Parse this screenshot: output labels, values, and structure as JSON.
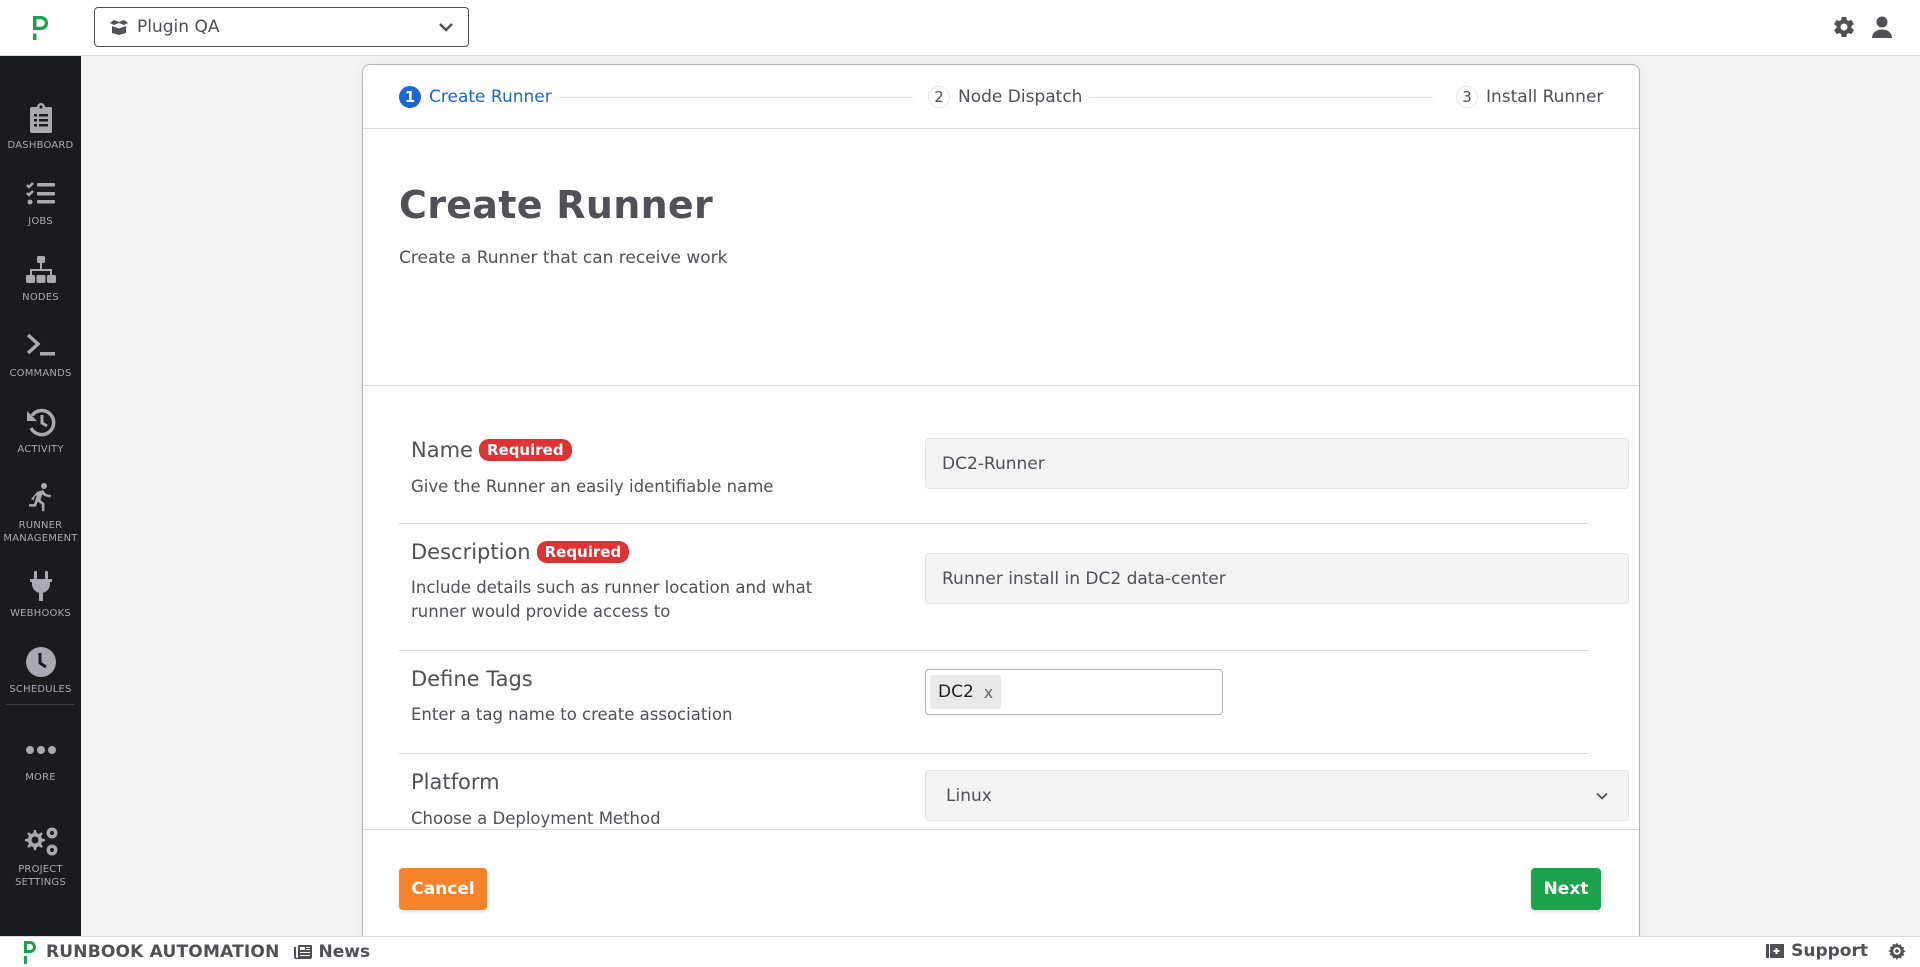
{
  "app": {
    "name": "Runbook Automation",
    "brand_color": "#1aa24d"
  },
  "topbar": {
    "project_select": {
      "icon": "box-open-icon",
      "value": "Plugin QA"
    },
    "icons": [
      "gear-icon",
      "user-icon"
    ]
  },
  "sidebar": {
    "items": [
      {
        "label": "Dashboard",
        "icon": "clipboard-list-icon"
      },
      {
        "label": "Jobs",
        "icon": "tasks-list-icon"
      },
      {
        "label": "Nodes",
        "icon": "sitemap-icon"
      },
      {
        "label": "Commands",
        "icon": "terminal-icon"
      },
      {
        "label": "Activity",
        "icon": "history-icon"
      },
      {
        "label": "Runner Management",
        "icon": "running-icon"
      },
      {
        "label": "Webhooks",
        "icon": "plug-icon"
      },
      {
        "label": "Schedules",
        "icon": "clock-icon"
      },
      {
        "label": "More",
        "icon": "ellipsis-icon"
      },
      {
        "label": "Project Settings",
        "icon": "cogs-icon"
      }
    ]
  },
  "stepper": {
    "steps": [
      {
        "number": "1",
        "label": "Create Runner",
        "active": true
      },
      {
        "number": "2",
        "label": "Node Dispatch",
        "active": false
      },
      {
        "number": "3",
        "label": "Install Runner",
        "active": false
      }
    ],
    "active_color": "#1a66d2"
  },
  "page": {
    "title": "Create Runner",
    "subtitle": "Create a Runner that can receive work"
  },
  "form": {
    "required_badge": "Required",
    "required_color": "#de3234",
    "name": {
      "label": "Name",
      "help": "Give the Runner an easily identifiable name",
      "value": "DC2-Runner"
    },
    "description": {
      "label": "Description",
      "help": "Include details such as runner location and what runner would provide access to",
      "value": "Runner install in DC2 data-center"
    },
    "tags": {
      "label": "Define Tags",
      "help": "Enter a tag name to create association",
      "values": [
        "DC2"
      ],
      "remove_glyph": "x"
    },
    "platform": {
      "label": "Platform",
      "help": "Choose a Deployment Method",
      "selected": "Linux"
    }
  },
  "actions": {
    "cancel_label": "Cancel",
    "cancel_color": "#f8822a",
    "next_label": "Next",
    "next_color": "#1aa24d"
  },
  "bottombar": {
    "brand": "RUNBOOK AUTOMATION",
    "news_label": "News",
    "support_label": "Support"
  }
}
